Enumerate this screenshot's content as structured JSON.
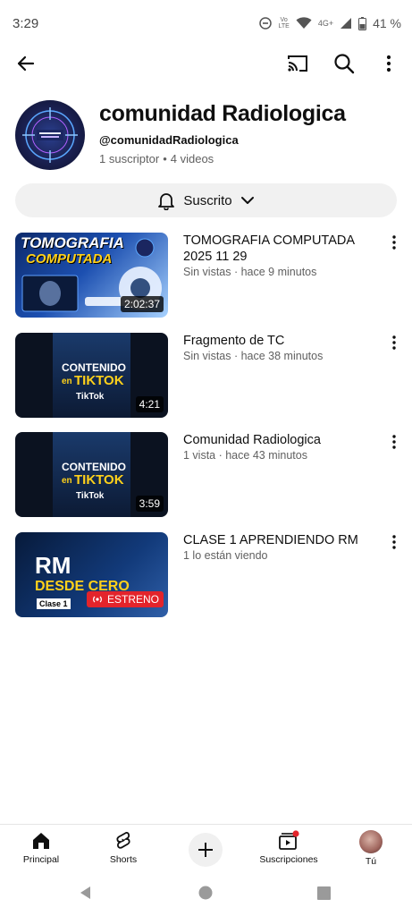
{
  "status_bar": {
    "time": "3:29",
    "network_top": "Vo",
    "network_bottom": "LTE",
    "signal_label": "4G+",
    "battery": "41 %"
  },
  "top_bar": {
    "icons": [
      "back-arrow-icon",
      "cast-icon",
      "search-icon",
      "more-vert-icon"
    ]
  },
  "channel": {
    "name": "comunidad Radiologica",
    "handle": "@comunidadRadiologica",
    "subscribers": "1 suscriptor",
    "separator": "•",
    "video_count": "4 videos",
    "subscribed_label": "Suscrito"
  },
  "videos": [
    {
      "title": "TOMOGRAFIA  COMPUTADA 2025 11 29",
      "meta": "Sin vistas · hace 9 minutos",
      "duration": "2:02:37",
      "thumb_line1": "TOMOGRAFIA",
      "thumb_line2": "COMPUTADA"
    },
    {
      "title": "Fragmento de TC",
      "meta": "Sin vistas · hace 38 minutos",
      "duration": "4:21",
      "thumb_line1": "CONTENIDO",
      "thumb_line2": "en",
      "thumb_line3": "TIKTOK",
      "thumb_brand": "TikTok"
    },
    {
      "title": "Comunidad Radiologica",
      "meta": "1 vista · hace 43 minutos",
      "duration": "3:59",
      "thumb_line1": "CONTENIDO",
      "thumb_line2": "en",
      "thumb_line3": "TIKTOK",
      "thumb_brand": "TikTok"
    },
    {
      "title": "CLASE 1 APRENDIENDO RM",
      "meta": "1 lo están viendo",
      "thumb_line1": "RM",
      "thumb_line2": "DESDE CERO",
      "thumb_tag": "Clase 1",
      "premiere_label": "ESTRENO"
    }
  ],
  "bottom_nav": {
    "home": "Principal",
    "shorts": "Shorts",
    "subscriptions": "Suscripciones",
    "you": "Tú"
  },
  "colors": {
    "accent_red": "#e3242b",
    "pill_bg": "#f1f1f1",
    "secondary_text": "#606060"
  }
}
